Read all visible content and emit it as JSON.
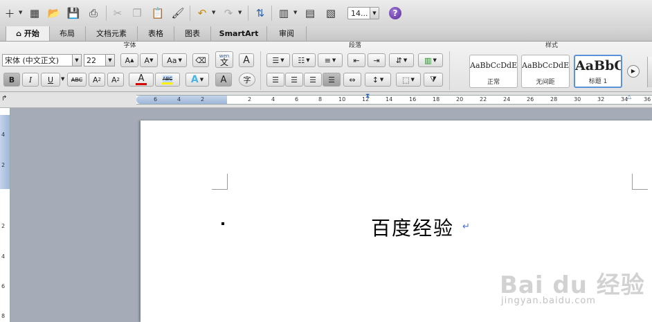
{
  "toolbar": {
    "zoom_value": "14...",
    "help_label": "?"
  },
  "tabs": [
    {
      "label": "开始",
      "active": true
    },
    {
      "label": "布局"
    },
    {
      "label": "文档元素"
    },
    {
      "label": "表格"
    },
    {
      "label": "图表"
    },
    {
      "label": "SmartArt"
    },
    {
      "label": "审阅"
    }
  ],
  "ribbon": {
    "font_group_title": "字体",
    "paragraph_group_title": "段落",
    "styles_group_title": "样式",
    "font_name": "宋体 (中文正文)",
    "font_size": "22",
    "wen_label": "wen",
    "wen_char": "文",
    "A_label": "A",
    "aa_label": "Aa",
    "grow_label": "A",
    "shrink_label": "A",
    "bold": "B",
    "italic": "I",
    "underline": "U",
    "strike": "ABC",
    "superscript": "A",
    "subscript": "A",
    "font_color": "A",
    "highlight": "ABC",
    "text_effect": "A",
    "char_shade": "A",
    "enclose": "字",
    "styles": [
      {
        "sample": "AaBbCcDdEe",
        "caption": "正常"
      },
      {
        "sample": "AaBbCcDdEe",
        "caption": "无间距"
      },
      {
        "sample": "AaBbC",
        "caption": "标题 1"
      }
    ]
  },
  "ruler": {
    "labels": [
      "6",
      "4",
      "2",
      "2",
      "4",
      "6",
      "8",
      "10",
      "12",
      "14",
      "16",
      "18",
      "20",
      "22",
      "24",
      "26",
      "28",
      "30",
      "32",
      "34",
      "36"
    ],
    "vertical_labels": [
      "4",
      "2",
      "2",
      "4",
      "6",
      "8"
    ]
  },
  "document": {
    "heading": "百度经验",
    "para_mark": "↵"
  },
  "watermark": {
    "text": "Bai du 经验",
    "url": "jingyan.baidu.com"
  }
}
